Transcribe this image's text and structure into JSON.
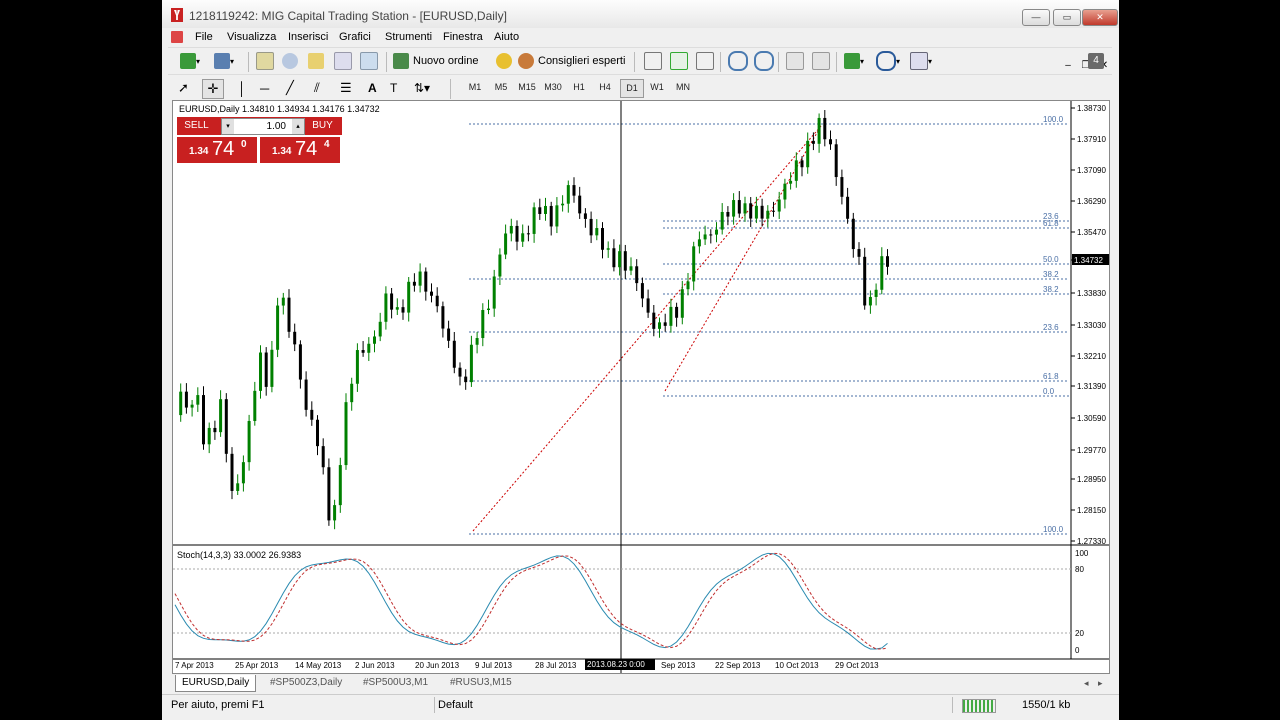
{
  "window": {
    "title": "1218119242: MIG Capital Trading Station - [EURUSD,Daily]"
  },
  "menu": [
    "File",
    "Visualizza",
    "Inserisci",
    "Grafici",
    "Strumenti",
    "Finestra",
    "Aiuto"
  ],
  "toolbar": {
    "new_order": "Nuovo ordine",
    "expert_advisors": "Consiglieri esperti"
  },
  "timeframes": [
    "M1",
    "M5",
    "M15",
    "M30",
    "H1",
    "H4",
    "D1",
    "W1",
    "MN"
  ],
  "active_timeframe": "D1",
  "chart": {
    "header": "EURUSD,Daily  1.34810 1.34934 1.34176 1.34732",
    "trade_panel": {
      "sell": "SELL",
      "buy": "BUY",
      "lot": "1.00",
      "bid_small": "1.34",
      "bid_big": "74",
      "bid_sup": "0",
      "ask_small": "1.34",
      "ask_big": "74",
      "ask_sup": "4"
    },
    "price_axis": [
      "1.38730",
      "1.37910",
      "1.37090",
      "1.36290",
      "1.35470",
      "1.34732",
      "1.33830",
      "1.33030",
      "1.32210",
      "1.31390",
      "1.30590",
      "1.29770",
      "1.28950",
      "1.28150",
      "1.27330"
    ],
    "current_price": "1.34732",
    "fibo_labels": [
      "100.0",
      "23.6",
      "61.8",
      "50.0",
      "38.2",
      "38.2",
      "23.6",
      "61.8",
      "0.0",
      "100.0"
    ],
    "stoch_header": "Stoch(14,3,3) 33.0002 26.9383",
    "stoch_axis": [
      "100",
      "80",
      "20",
      "0"
    ],
    "date_axis": [
      "7 Apr 2013",
      "25 Apr 2013",
      "14 May 2013",
      "2 Jun 2013",
      "20 Jun 2013",
      "9 Jul 2013",
      "28 Jul 2013",
      "2013.08.23 0:00",
      "Sep 2013",
      "22 Sep 2013",
      "10 Oct 2013",
      "29 Oct 2013"
    ]
  },
  "tabs": [
    "EURUSD,Daily",
    "#SP500Z3,Daily",
    "#SP500U3,M1",
    "#RUSU3,M15"
  ],
  "status": {
    "help": "Per aiuto, premi F1",
    "profile": "Default",
    "traffic": "1550/1 kb"
  },
  "colors": {
    "up": "#008000",
    "down": "#000000",
    "fibo": "#4a6fa5",
    "trade_red": "#c82020"
  }
}
